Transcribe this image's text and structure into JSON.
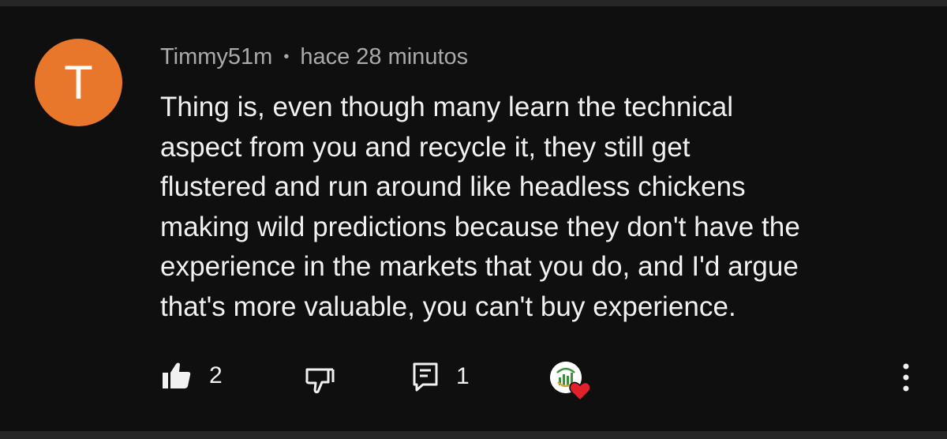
{
  "comment": {
    "avatar_letter": "T",
    "author": "Timmy51m",
    "separator": "•",
    "time": "hace 28 minutos",
    "lines": [
      "Thing is, even though many learn the technical",
      "aspect from you and recycle it, they still get",
      "flustered and run around like headless chickens",
      "making wild predictions because they don't have the",
      "experience in the markets that you do, and I'd argue",
      "that's more valuable, you can't buy experience."
    ]
  },
  "actions": {
    "like_count": "2",
    "reply_count": "1"
  },
  "colors": {
    "background": "#0f0f0f",
    "avatar": "#e8762b",
    "meta_text": "#aaaaaa",
    "heart": "#e0202a"
  }
}
